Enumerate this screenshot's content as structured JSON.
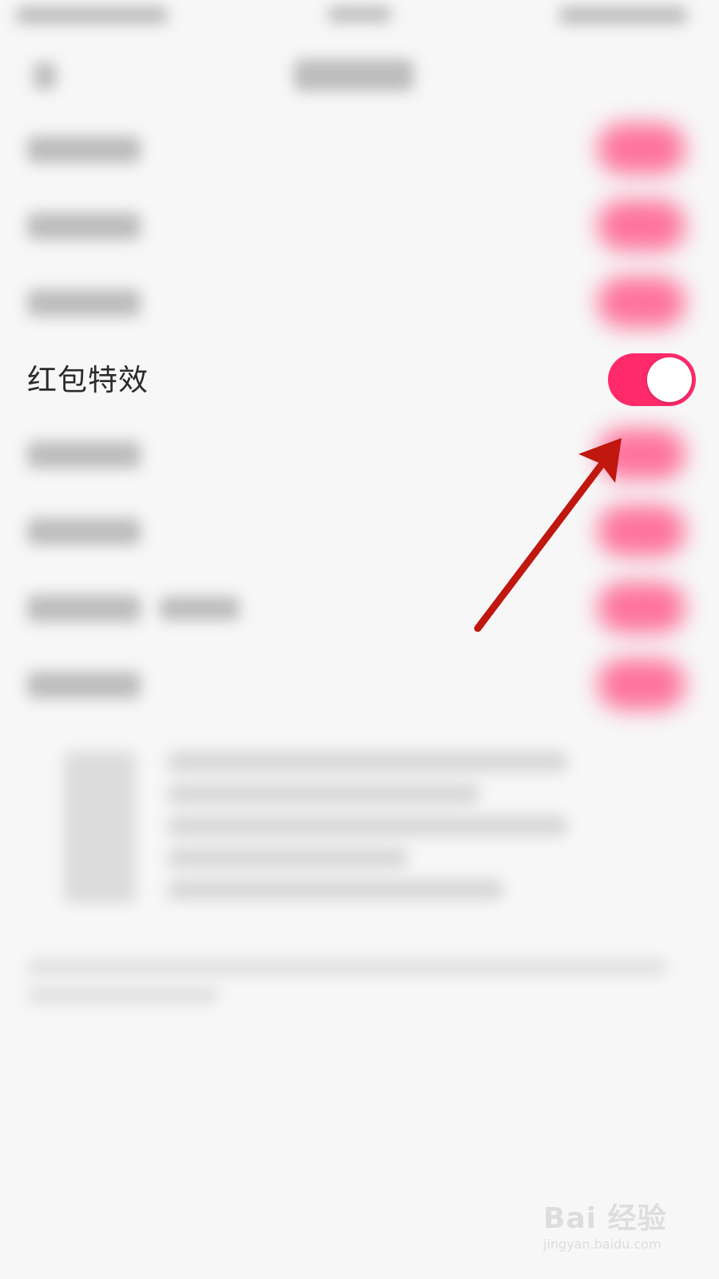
{
  "settings": {
    "visible_row": {
      "label": "红包特效",
      "toggle_on": true
    }
  },
  "colors": {
    "background": "#f7f7f7",
    "toggle_on": "#ff2a6a",
    "toggle_knob": "#ffffff",
    "label_text": "#2b2b2b",
    "annotation_arrow": "#c0170f"
  },
  "watermark": {
    "brand": "Bai  经验",
    "url": "jingyan.baidu.com"
  }
}
